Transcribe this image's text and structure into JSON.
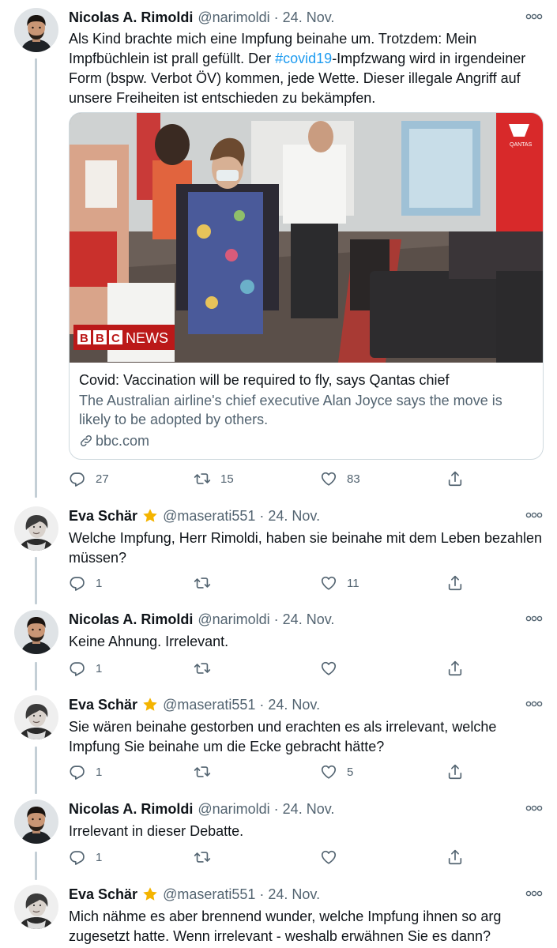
{
  "colors": {
    "accent": "#1d9bf0",
    "muted": "#536471",
    "thread_line": "#c4cfd6",
    "text": "#0f1419",
    "star": "#f4b400"
  },
  "tweets": [
    {
      "name": "Nicolas A. Rimoldi",
      "handle": "@narimoldi",
      "date": "24. Nov.",
      "text_before": "Als Kind brachte mich eine Impfung beinahe um. Trotzdem: Mein Impfbüchlein ist prall gefüllt. Der ",
      "hashtag": "#covid19",
      "text_after": "-Impfzwang wird in irgendeiner Form (bspw. Verbot ÖV) kommen, jede Wette. Dieser illegale Angriff auf unsere Freiheiten ist entschieden zu bekämpfen.",
      "card": {
        "badge_letters": [
          "B",
          "B",
          "C"
        ],
        "badge_word": "NEWS",
        "title": "Covid: Vaccination will be required to fly, says Qantas chief",
        "description": "The Australian airline's chief executive Alan Joyce says the move is likely to be adopted by others.",
        "domain": "bbc.com",
        "sign_text": "QANTAS"
      },
      "replies": "27",
      "retweets": "15",
      "likes": "83"
    },
    {
      "name": "Eva Schär",
      "handle": "@maserati551",
      "date": "24. Nov.",
      "text": "Welche Impfung, Herr Rimoldi, haben sie beinahe mit dem Leben bezahlen müssen?",
      "replies": "1",
      "retweets": "",
      "likes": "11"
    },
    {
      "name": "Nicolas A. Rimoldi",
      "handle": "@narimoldi",
      "date": "24. Nov.",
      "text": "Keine Ahnung. Irrelevant.",
      "replies": "1",
      "retweets": "",
      "likes": ""
    },
    {
      "name": "Eva Schär",
      "handle": "@maserati551",
      "date": "24. Nov.",
      "text": "Sie wären beinahe gestorben und erachten es als irrelevant, welche Impfung Sie beinahe um die Ecke gebracht hätte?",
      "replies": "1",
      "retweets": "",
      "likes": "5"
    },
    {
      "name": "Nicolas A. Rimoldi",
      "handle": "@narimoldi",
      "date": "24. Nov.",
      "text": "Irrelevant in dieser Debatte.",
      "replies": "1",
      "retweets": "",
      "likes": ""
    },
    {
      "name": "Eva Schär",
      "handle": "@maserati551",
      "date": "24. Nov.",
      "text": "Mich nähme es aber brennend wunder, welche Impfung ihnen so arg zugesetzt hatte. Wenn irrelevant - weshalb erwähnen Sie es dann?"
    }
  ]
}
